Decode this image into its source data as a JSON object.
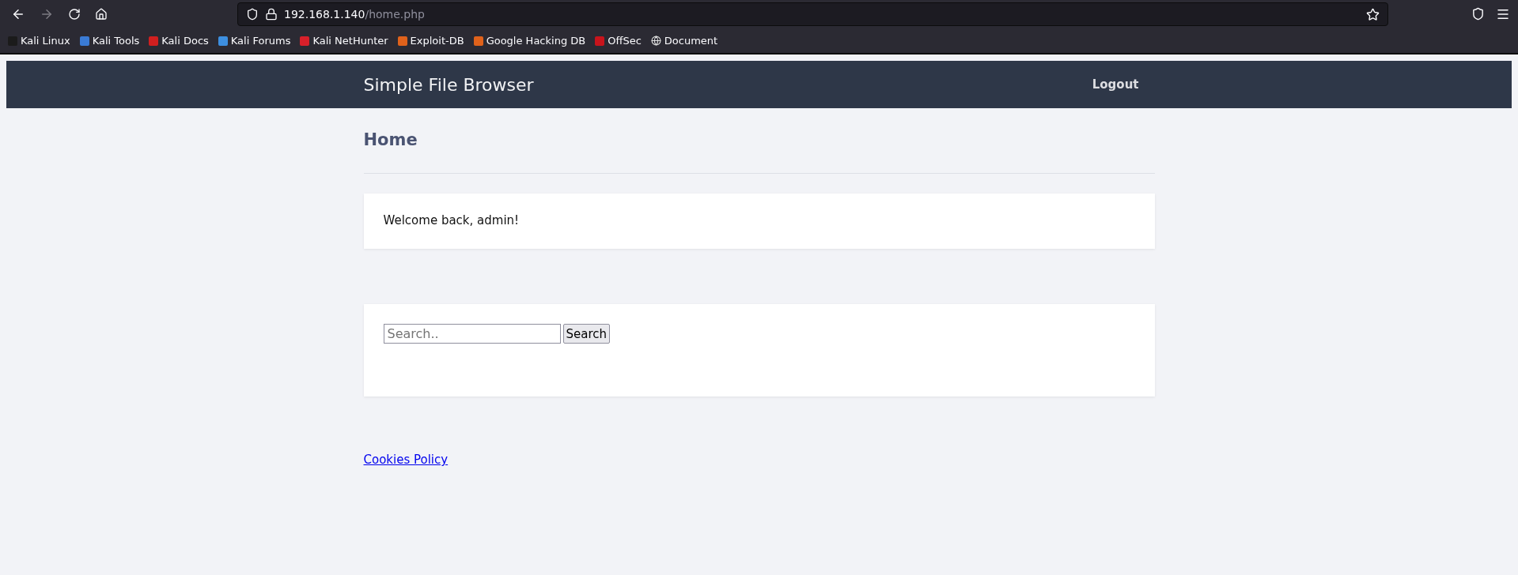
{
  "browser": {
    "url_host": "192.168.1.140",
    "url_path": "/home.php",
    "bookmarks": [
      {
        "label": "Kali Linux",
        "color": "#1b1b1b"
      },
      {
        "label": "Kali Tools",
        "color": "#3a7bd5"
      },
      {
        "label": "Kali Docs",
        "color": "#d11f1f"
      },
      {
        "label": "Kali Forums",
        "color": "#3d8fe0"
      },
      {
        "label": "Kali NetHunter",
        "color": "#d8202a"
      },
      {
        "label": "Exploit-DB",
        "color": "#e0621b"
      },
      {
        "label": "Google Hacking DB",
        "color": "#e0621b"
      },
      {
        "label": "OffSec",
        "color": "#c8141c"
      },
      {
        "label": "Document",
        "color": "#e0e0e0"
      }
    ]
  },
  "navbar": {
    "title": "Simple File Browser",
    "logout": "Logout"
  },
  "page": {
    "heading": "Home",
    "welcome": "Welcome back, admin!",
    "search": {
      "placeholder": "Search..",
      "button": "Search"
    },
    "footer_link": "Cookies Policy"
  }
}
